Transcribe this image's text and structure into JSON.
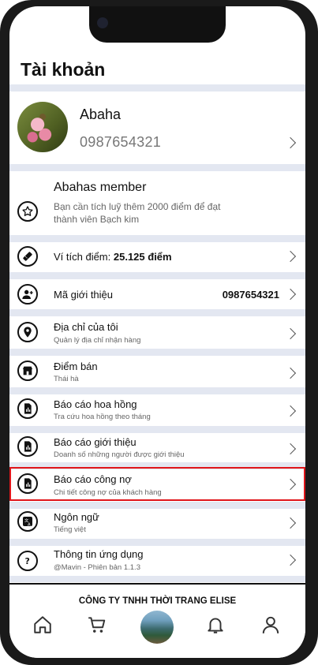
{
  "page": {
    "title": "Tài khoản"
  },
  "profile": {
    "name": "Abaha",
    "phone": "0987654321"
  },
  "member": {
    "title": "Abahas member",
    "description": "Bạn cần tích luỹ thêm 2000 điểm để đạt thành viên Bạch kim"
  },
  "wallet": {
    "label": "Ví tích điểm:",
    "value": "25.125 điểm"
  },
  "referral": {
    "label": "Mã giới thiệu",
    "value": "0987654321"
  },
  "menu": [
    {
      "title": "Địa chỉ của tôi",
      "subtitle": "Quản lý địa chỉ nhận hàng"
    },
    {
      "title": "Điểm bán",
      "subtitle": "Thái hà"
    },
    {
      "title": "Báo cáo hoa hồng",
      "subtitle": "Tra cứu hoa hồng theo tháng"
    },
    {
      "title": "Báo cáo giới thiệu",
      "subtitle": "Doanh số những người được giới thiệu"
    },
    {
      "title": "Báo cáo công nợ",
      "subtitle": "Chi tiết công nợ của khách hàng"
    },
    {
      "title": "Ngôn ngữ",
      "subtitle": "Tiếng việt"
    },
    {
      "title": "Thông tin ứng dụng",
      "subtitle": "@Mavin - Phiên bản 1.1.3"
    }
  ],
  "company": "CÔNG TY TNHH THỜI TRANG ELISE",
  "highlight_color": "#e0161b",
  "tabbar": [
    "home-icon",
    "cart-icon",
    "center-avatar",
    "bell-icon",
    "user-icon"
  ]
}
